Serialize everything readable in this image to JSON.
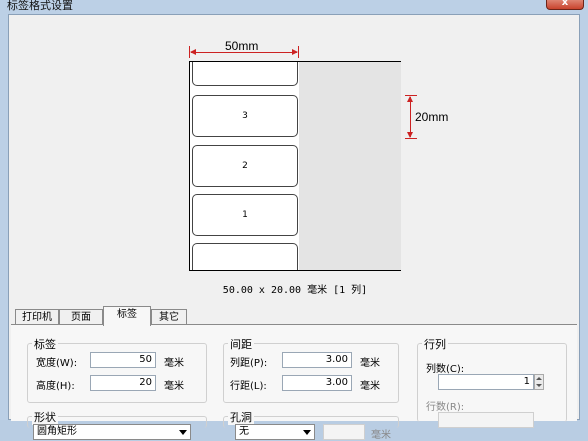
{
  "window": {
    "title": "标签格式设置",
    "close_label": "x"
  },
  "preview": {
    "width_dim": "50mm",
    "height_dim": "20mm",
    "labels": [
      "",
      "3",
      "2",
      "1",
      ""
    ],
    "size_text": "50.00 x 20.00 毫米 [1 列]"
  },
  "tabs": [
    {
      "label": "打印机",
      "active": false
    },
    {
      "label": "页面",
      "active": false
    },
    {
      "label": "标签",
      "active": true
    },
    {
      "label": "其它",
      "active": false
    }
  ],
  "label_group": {
    "title": "标签",
    "width_label": "宽度(W):",
    "width_value": "50",
    "height_label": "高度(H):",
    "height_value": "20",
    "unit": "毫米"
  },
  "spacing_group": {
    "title": "间距",
    "col_label": "列距(P):",
    "col_value": "3.00",
    "row_label": "行距(L):",
    "row_value": "3.00",
    "unit": "毫米"
  },
  "rowcol_group": {
    "title": "行列",
    "cols_label": "列数(C):",
    "cols_value": "1",
    "rows_label": "行数(R):"
  },
  "shape_group": {
    "title": "形状",
    "value": "圆角矩形"
  },
  "hole_group": {
    "title": "孔洞",
    "value": "无",
    "unit": "毫米"
  }
}
